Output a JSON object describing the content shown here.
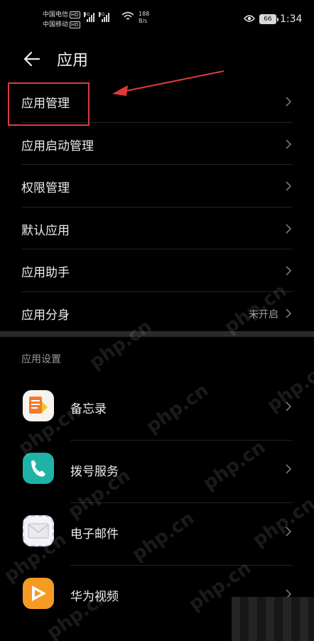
{
  "status_bar": {
    "carrier_1": "中国电信",
    "carrier_2": "中国移动",
    "hd_label": "HD",
    "net_type_1": "4G",
    "net_type_2": "4G",
    "speed_value": "188",
    "speed_unit": "B/s",
    "battery": "66",
    "time": "1:34"
  },
  "header": {
    "title": "应用"
  },
  "menu": {
    "items": [
      {
        "label": "应用管理",
        "value": ""
      },
      {
        "label": "应用启动管理",
        "value": ""
      },
      {
        "label": "权限管理",
        "value": ""
      },
      {
        "label": "默认应用",
        "value": ""
      },
      {
        "label": "应用助手",
        "value": ""
      },
      {
        "label": "应用分身",
        "value": "未开启"
      }
    ]
  },
  "app_settings": {
    "section_title": "应用设置",
    "apps": [
      {
        "label": "备忘录",
        "icon": "memo-icon"
      },
      {
        "label": "拨号服务",
        "icon": "phone-icon"
      },
      {
        "label": "电子邮件",
        "icon": "email-icon"
      },
      {
        "label": "华为视频",
        "icon": "video-icon"
      }
    ]
  },
  "watermark": "php.cn",
  "colors": {
    "background": "#000000",
    "highlight": "#e03a3a",
    "secondary_text": "#9a9a9a"
  }
}
